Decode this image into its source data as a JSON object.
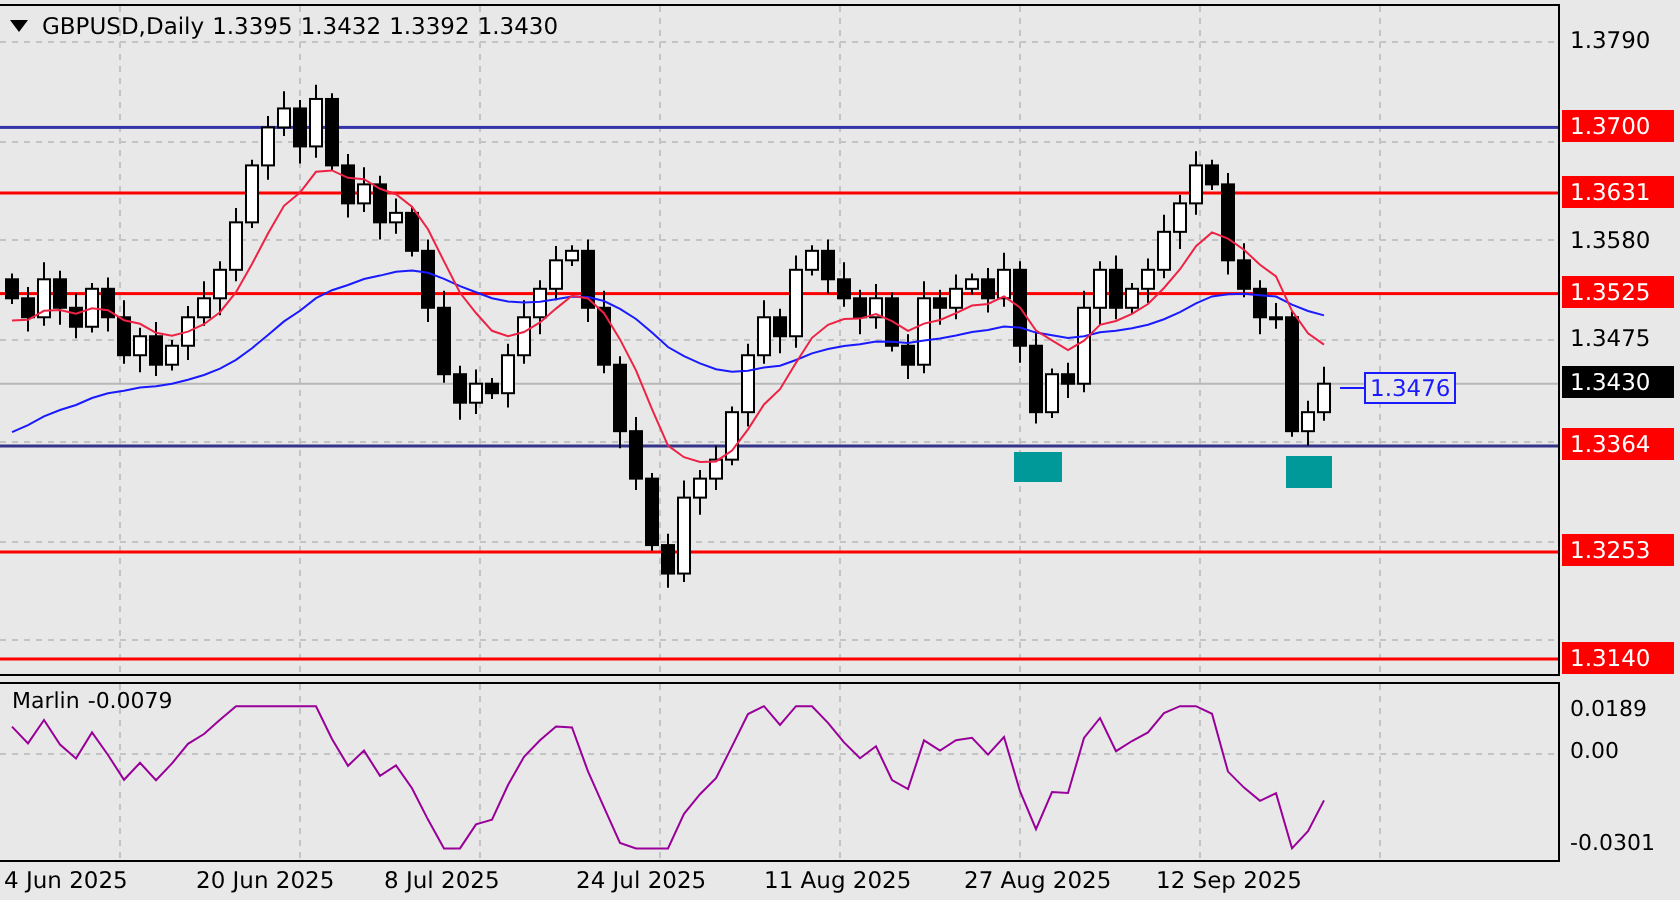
{
  "header": {
    "symbol": "GBPUSD,Daily",
    "ohlc": [
      "1.3395",
      "1.3432",
      "1.3392",
      "1.3430"
    ]
  },
  "price_axis": {
    "ticks": [
      "1.3790",
      "1.3580",
      "1.3475"
    ]
  },
  "levels": [
    {
      "label": "1.3700",
      "color": "#3333aa"
    },
    {
      "label": "1.3631",
      "color": "#ff0000"
    },
    {
      "label": "1.3525",
      "color": "#ff0000"
    },
    {
      "label": "1.3364",
      "color": "#333388"
    },
    {
      "label": "1.3253",
      "color": "#ff0000"
    },
    {
      "label": "1.3140",
      "color": "#ff0000"
    }
  ],
  "current_price": "1.3430",
  "ma_label": "1.3476",
  "indicator": {
    "name": "Marlin",
    "value": "-0.0079",
    "ticks": [
      "0.0189",
      "0.00",
      "-0.0301"
    ]
  },
  "dates": [
    "4 Jun 2025",
    "20 Jun 2025",
    "8 Jul 2025",
    "24 Jul 2025",
    "11 Aug 2025",
    "27 Aug 2025",
    "12 Sep 2025"
  ]
}
